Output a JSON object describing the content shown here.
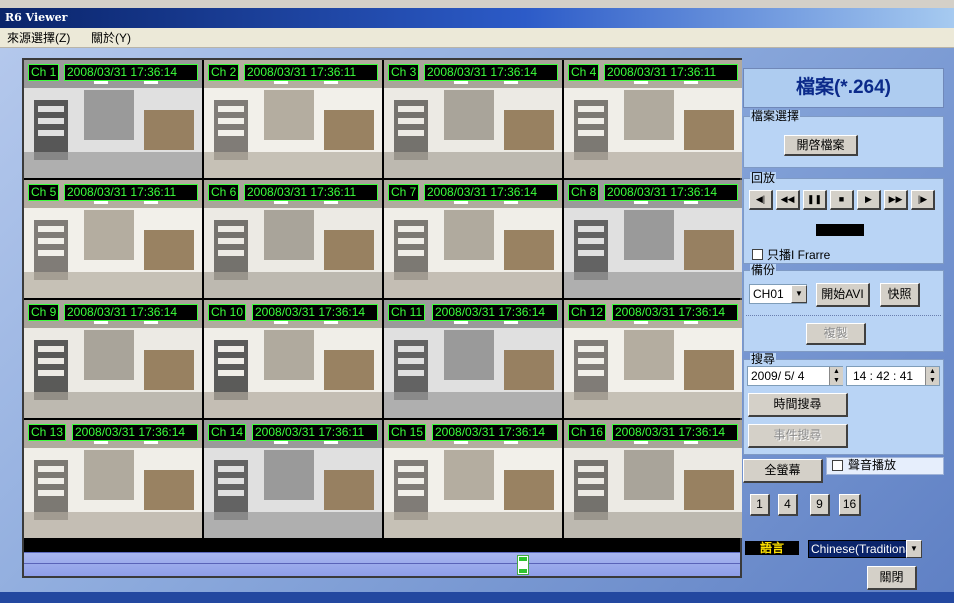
{
  "window": {
    "title": "R6 Viewer"
  },
  "menu": [
    {
      "label": "來源選擇(Z)"
    },
    {
      "label": "關於(Y)"
    }
  ],
  "cameras": [
    {
      "label": "Ch 1",
      "timestamp": "2008/03/31  17:36:14"
    },
    {
      "label": "Ch 2",
      "timestamp": "2008/03/31  17:36:11"
    },
    {
      "label": "Ch 3",
      "timestamp": "2008/03/31  17:36:14"
    },
    {
      "label": "Ch 4",
      "timestamp": "2008/03/31  17:36:11"
    },
    {
      "label": "Ch 5",
      "timestamp": "2008/03/31  17:36:11"
    },
    {
      "label": "Ch 6",
      "timestamp": "2008/03/31  17:36:11"
    },
    {
      "label": "Ch 7",
      "timestamp": "2008/03/31  17:36:14"
    },
    {
      "label": "Ch 8",
      "timestamp": "2008/03/31  17:36:14"
    },
    {
      "label": "Ch 9",
      "timestamp": "2008/03/31  17:36:14"
    },
    {
      "label": "Ch 10",
      "timestamp": "2008/03/31  17:36:14"
    },
    {
      "label": "Ch 11",
      "timestamp": "2008/03/31  17:36:14"
    },
    {
      "label": "Ch 12",
      "timestamp": "2008/03/31  17:36:14"
    },
    {
      "label": "Ch 13",
      "timestamp": "2008/03/31  17:36:14"
    },
    {
      "label": "Ch 14",
      "timestamp": "2008/03/31  17:36:11"
    },
    {
      "label": "Ch 15",
      "timestamp": "2008/03/31  17:36:14"
    },
    {
      "label": "Ch 16",
      "timestamp": "2008/03/31  17:36:14"
    }
  ],
  "file": {
    "header": "檔案(*.264)",
    "group_title": "檔案選擇",
    "open_button": "開啓檔案"
  },
  "playback": {
    "group_title": "回放",
    "buttons": [
      {
        "icon": "step-back-icon",
        "glyph": "◀|"
      },
      {
        "icon": "rewind-icon",
        "glyph": "◀◀"
      },
      {
        "icon": "pause-icon",
        "glyph": "❚❚"
      },
      {
        "icon": "stop-icon",
        "glyph": "■"
      },
      {
        "icon": "play-icon",
        "glyph": "▶"
      },
      {
        "icon": "fast-forward-icon",
        "glyph": "▶▶"
      },
      {
        "icon": "step-forward-icon",
        "glyph": "|▶"
      }
    ],
    "iframe_only_label": "只播I Frarre"
  },
  "backup": {
    "group_title": "備份",
    "channel": "CH01",
    "start_avi_button": "開始AVI",
    "snapshot_button": "快照",
    "copy_button": "複製"
  },
  "search": {
    "group_title": "搜尋",
    "date": "2009/ 5/ 4",
    "time": "14 : 42 : 41",
    "time_search_button": "時間搜尋",
    "event_search_button": "事件搜尋"
  },
  "view": {
    "fullscreen_button": "全螢幕",
    "audio_label": "聲音播放",
    "layout_buttons": [
      "1",
      "4",
      "9",
      "16"
    ]
  },
  "language": {
    "label": "語言",
    "selected": "Chinese(Traditional)"
  },
  "close_button": "關閉",
  "colors": {
    "osd_green": "#3cff3c",
    "panel_blue": "#b9d4f5",
    "title_blue": "#0a246a"
  }
}
